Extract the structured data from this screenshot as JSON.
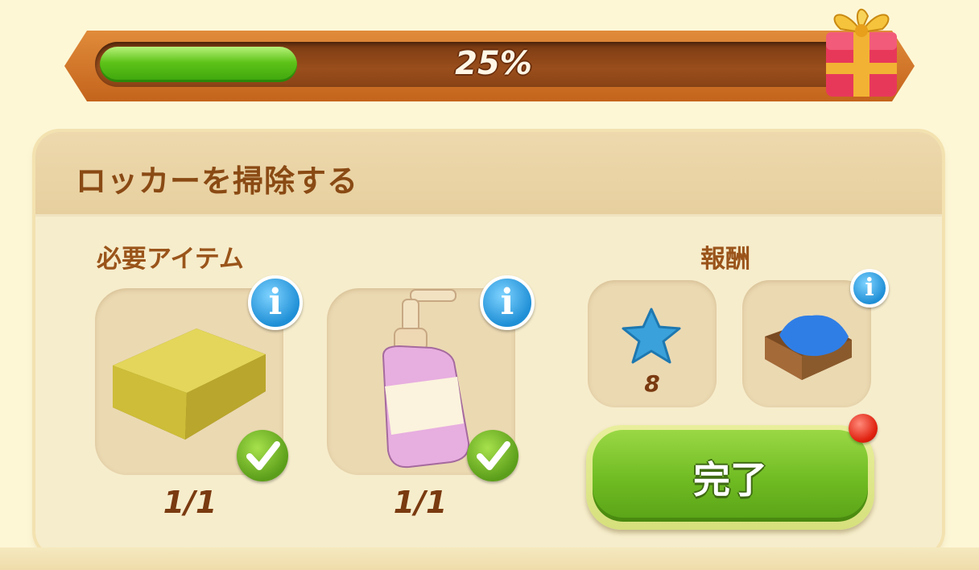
{
  "progress": {
    "value": 0.25,
    "label": "25%"
  },
  "task": {
    "title": "ロッカーを掃除する"
  },
  "required": {
    "label": "必要アイテム",
    "items": [
      {
        "icon": "sponge-icon",
        "count": "1/1",
        "done": true
      },
      {
        "icon": "soap-bottle-icon",
        "count": "1/1",
        "done": true
      }
    ]
  },
  "reward": {
    "label": "報酬",
    "items": [
      {
        "icon": "blue-star-icon",
        "count": "8"
      },
      {
        "icon": "crate-with-blue-cloth-icon"
      }
    ]
  },
  "complete_button": {
    "label": "完了"
  },
  "colors": {
    "accent_green": "#6fbb22",
    "title_brown": "#8a4a14",
    "info_blue": "#1f8fd6"
  }
}
